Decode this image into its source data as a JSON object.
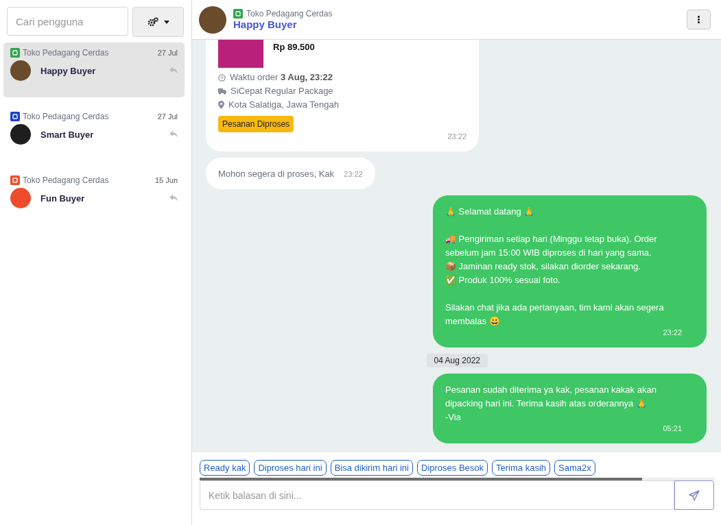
{
  "sidebar": {
    "search": {
      "placeholder": "Cari pengguna"
    },
    "conversations": [
      {
        "store": "Toko Pedagang Cerdas",
        "color": "#2ea44f",
        "date": "27 Jul",
        "name": "Happy Buyer",
        "selected": true
      },
      {
        "store": "Toko Pedagang Cerdas",
        "color": "#1a3fd0",
        "date": "27 Jul",
        "name": "Smart Buyer",
        "selected": false
      },
      {
        "store": "Toko Pedagang Cerdas",
        "color": "#ee4d2d",
        "date": "15 Jun",
        "name": "Fun Buyer",
        "selected": false
      }
    ]
  },
  "chat": {
    "header": {
      "store": "Toko Pedagang Cerdas",
      "color": "#2ea44f",
      "name": "Happy Buyer"
    },
    "messages": [
      {
        "kind": "order",
        "outgoing": false,
        "price": "Rp 89.500",
        "order_time": "Waktu order **3 Aug, 23:22**",
        "courier": "SiCepat Regular Package",
        "location": "Kota Salatiga, Jawa Tengah",
        "status": "Pesanan Diproses",
        "time": "23:22"
      },
      {
        "kind": "text",
        "outgoing": false,
        "text": "Mohon segera di proses, Kak",
        "time": "23:22"
      },
      {
        "kind": "text",
        "outgoing": true,
        "text": "🙏 Selamat datang 🙏\n\n🚚 Pengiriman setiap hari (Minggu tetap buka). Order sebelum jam 15:00 WIB diproses di hari yang sama.\n📦 Jaminan ready stok, silakan diorder sekarang.\n✅ Produk 100% sesuai foto.\n\nSilakan chat jika ada pertanyaan, tim kami akan segera membalas 😀",
        "time": "23:22"
      },
      {
        "kind": "date",
        "text": "04 Aug 2022"
      },
      {
        "kind": "text",
        "outgoing": true,
        "text": "Pesanan sudah diterima ya kak, pesanan kakak akan dipacking hari ini. Terima kasih atas orderannya 🙏\n-Via",
        "time": "05:21"
      }
    ],
    "quick_replies": [
      "Ready kak",
      "Diproses hari ini",
      "Bisa dikirim hari ini",
      "Diproses Besok",
      "Terima kasih",
      "Sama2x"
    ],
    "composer": {
      "placeholder": "Ketik balasan di sini..."
    }
  }
}
